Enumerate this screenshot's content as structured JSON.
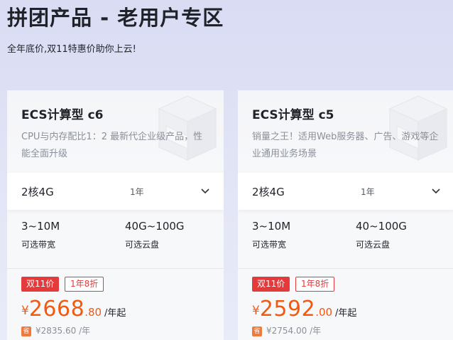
{
  "page": {
    "title": "拼团产品 - 老用户专区",
    "subtitle": "全年底价,双11特惠价助你上云!"
  },
  "colors": {
    "accent": "#f25a10",
    "sale_red": "#e33b3b",
    "background": "#d9dcf3"
  },
  "cards": [
    {
      "title": "ECS计算型 c6",
      "description": "CPU与内存配比1：2 最新代企业级产品，性能全面升级",
      "spec": "2核4G",
      "term": "1年",
      "bandwidth_value": "3~10M",
      "bandwidth_label": "可选带宽",
      "disk_value": "40G~100G",
      "disk_label": "可选云盘",
      "sale_badge": "双11价",
      "discount_badge": "1年8折",
      "currency": "¥",
      "price_int": "2668",
      "price_dec": ".80",
      "price_unit": "/年起",
      "save_icon": "省",
      "original_price": "¥2835.60 /年"
    },
    {
      "title": "ECS计算型 c5",
      "description": "销量之王！适用Web服务器、广告、游戏等企业通用业务场景",
      "spec": "2核4G",
      "term": "1年",
      "bandwidth_value": "3~10M",
      "bandwidth_label": "可选带宽",
      "disk_value": "40~100G",
      "disk_label": "可选云盘",
      "sale_badge": "双11价",
      "discount_badge": "1年8折",
      "currency": "¥",
      "price_int": "2592",
      "price_dec": ".00",
      "price_unit": "/年起",
      "save_icon": "省",
      "original_price": "¥2754.00 /年"
    }
  ],
  "icons": {
    "dropdown": "chevron-down-icon",
    "save": "save-badge-icon",
    "decoration": "server-box-illustration"
  }
}
